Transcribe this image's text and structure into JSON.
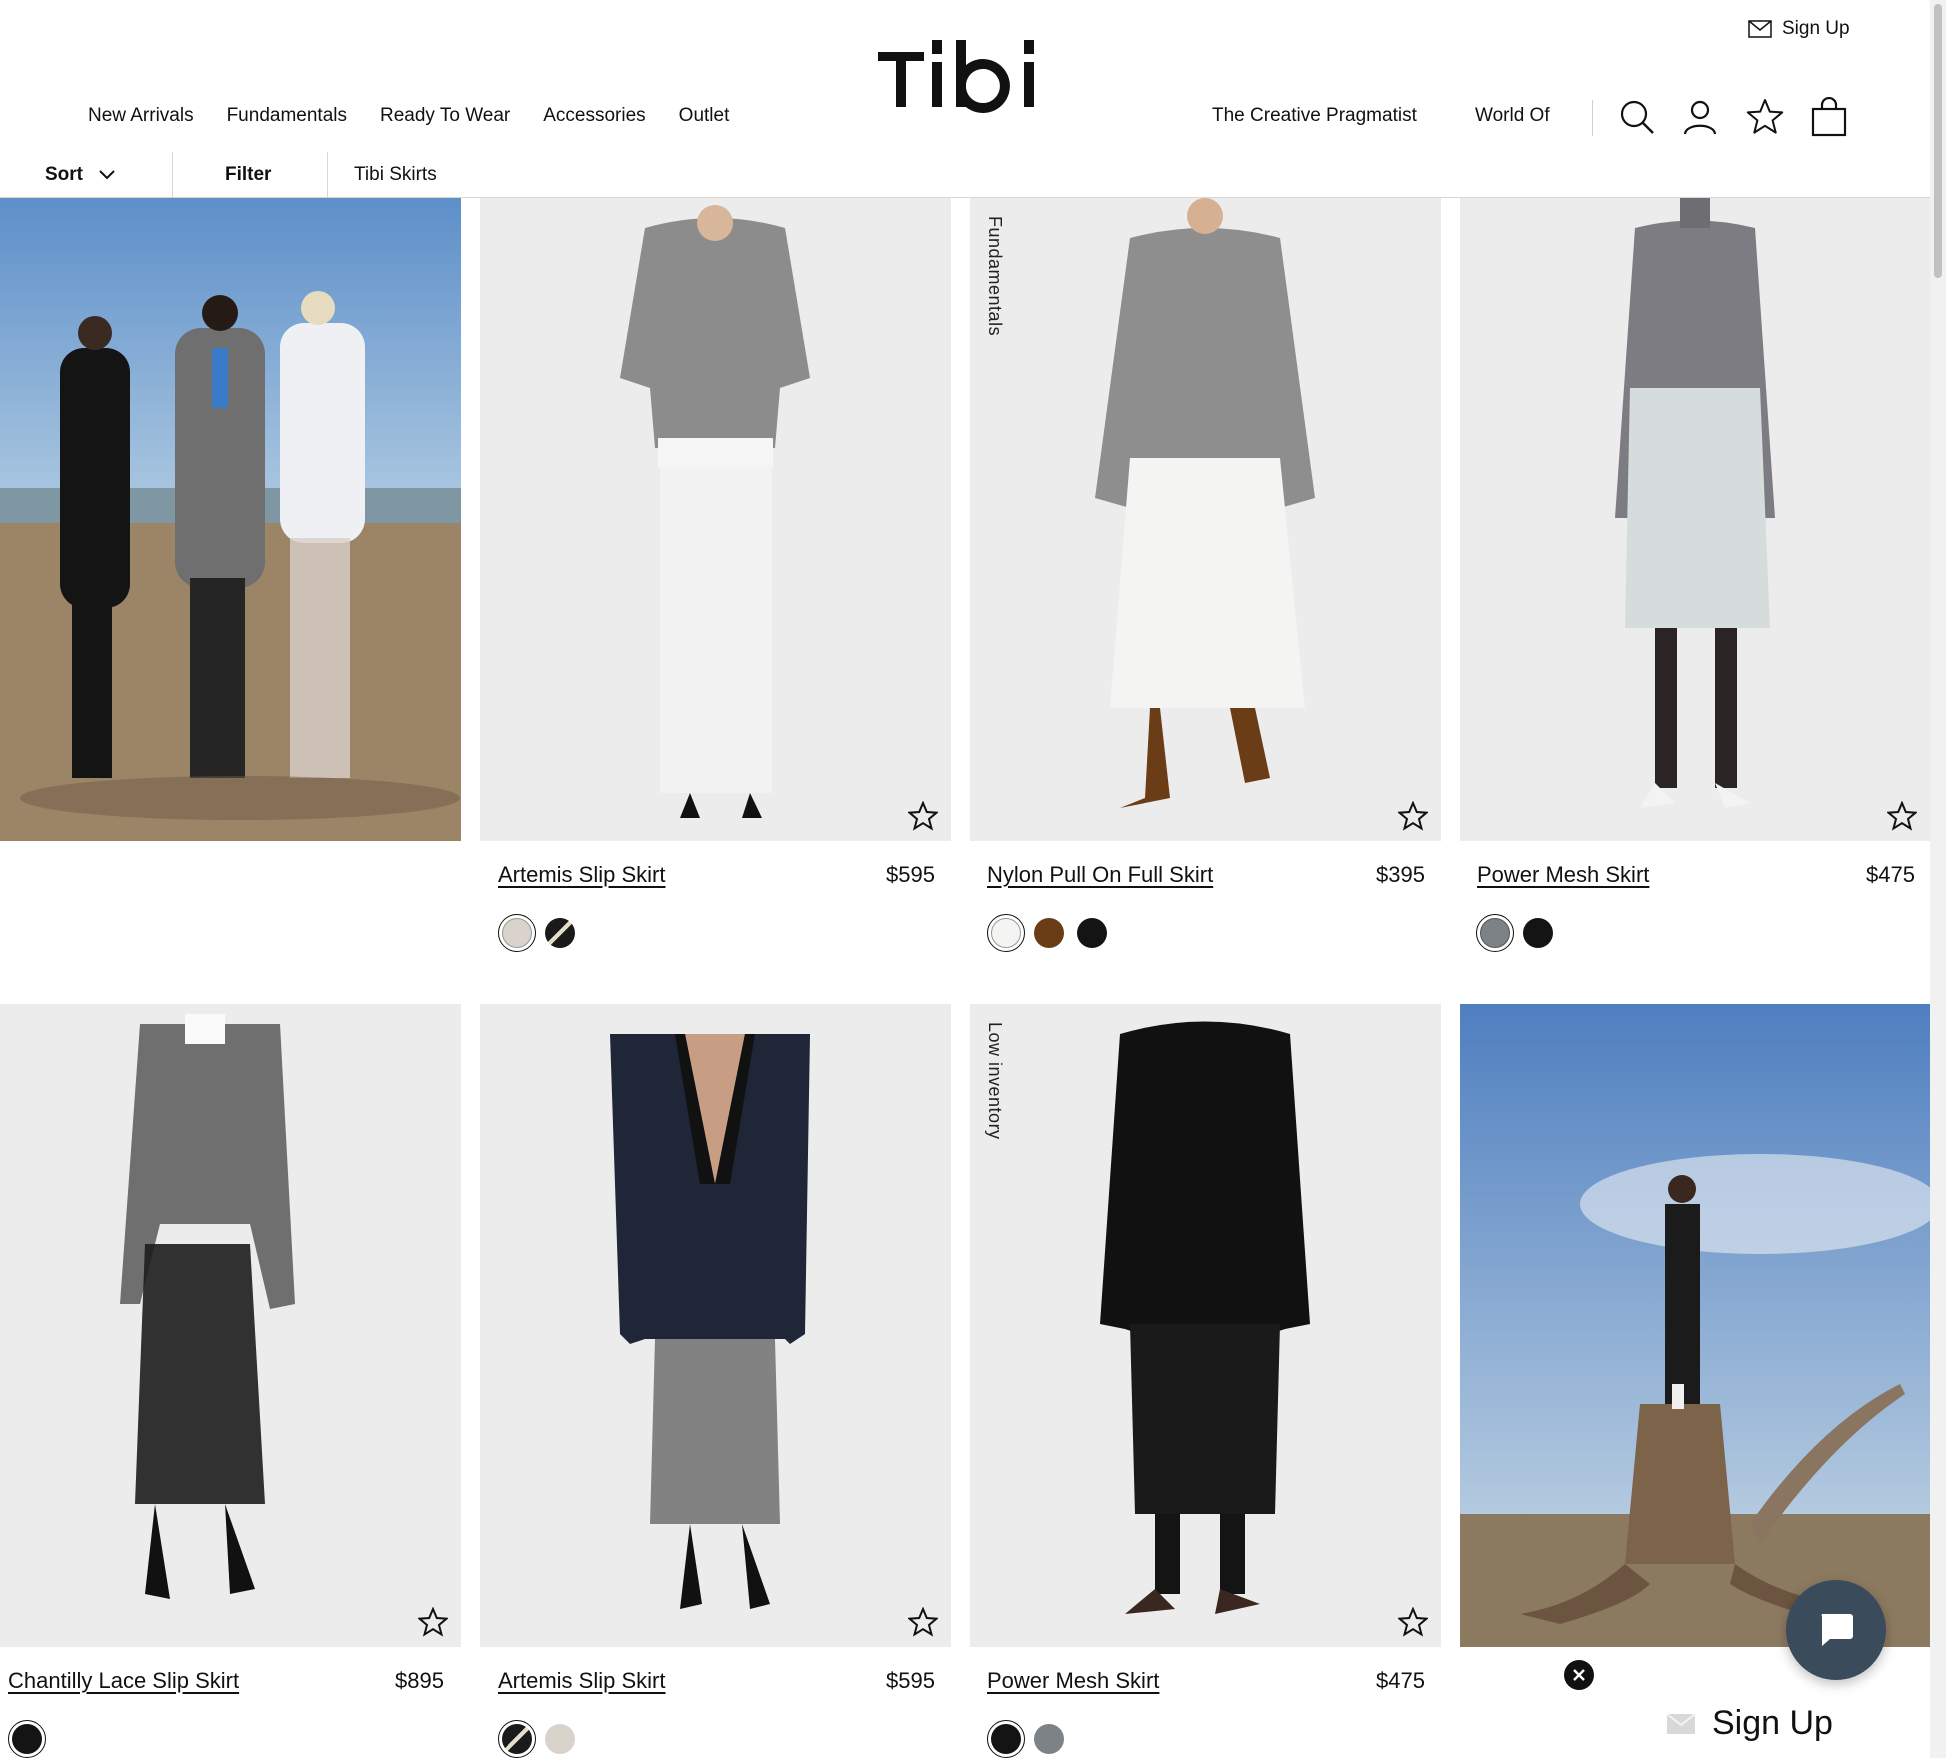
{
  "header": {
    "brand": "Tibi",
    "signup_label": "Sign Up",
    "nav_left": [
      "New Arrivals",
      "Fundamentals",
      "Ready To Wear",
      "Accessories",
      "Outlet"
    ],
    "nav_right": [
      "The Creative Pragmatist",
      "World Of"
    ]
  },
  "filterbar": {
    "sort_label": "Sort",
    "filter_label": "Filter",
    "category": "Tibi Skirts"
  },
  "products": [
    {
      "name": "Artemis Slip Skirt",
      "price": "$595",
      "swatches": [
        "#d9d3cc",
        "#1a1a1a"
      ],
      "label": ""
    },
    {
      "name": "Nylon Pull On Full Skirt",
      "price": "$395",
      "swatches": [
        "#f4f4f2",
        "#6b3d17",
        "#141414"
      ],
      "label": "Fundamentals"
    },
    {
      "name": "Power Mesh Skirt",
      "price": "$475",
      "swatches": [
        "#7c8286",
        "#141414"
      ],
      "label": ""
    },
    {
      "name": "Chantilly Lace Slip Skirt",
      "price": "$895",
      "swatches": [
        "#141414"
      ],
      "label": ""
    },
    {
      "name": "Artemis Slip Skirt",
      "price": "$595",
      "swatches": [
        "#1a1a1a",
        "#d9d3cc"
      ],
      "label": ""
    },
    {
      "name": "Power Mesh Skirt",
      "price": "$475",
      "swatches": [
        "#141414",
        "#7c8286"
      ],
      "label": "Low inventory"
    }
  ],
  "popup": {
    "signup_label": "Sign Up"
  },
  "colors": {
    "text": "#111111",
    "tile_bg": "#ededed",
    "chat_bg": "#3a4b5c"
  }
}
